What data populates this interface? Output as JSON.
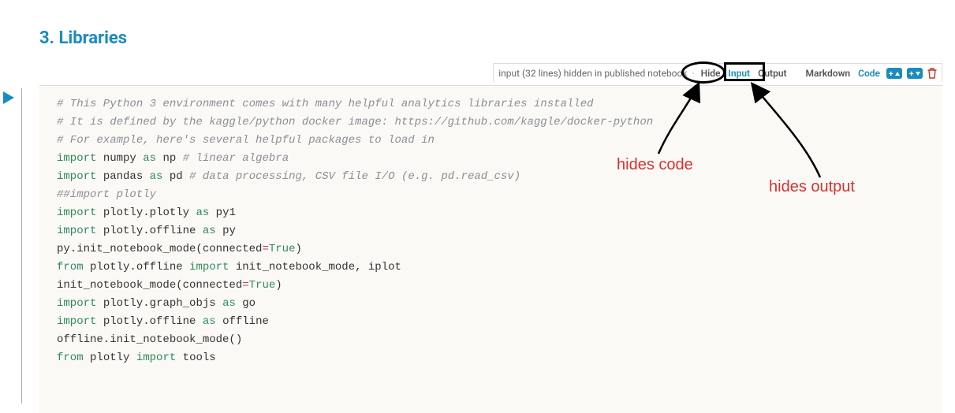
{
  "heading": "3. Libraries",
  "toolbar": {
    "hiddenMsg": "input (32 lines) hidden in published notebook",
    "separator": "·",
    "hide": "Hide",
    "input": "Input",
    "output": "Output",
    "markdown": "Markdown",
    "code": "Code"
  },
  "annotations": {
    "hidesCode": "hides code",
    "hidesOutput": "hides output"
  },
  "code": {
    "l1": "# This Python 3 environment comes with many helpful analytics libraries installed",
    "l2": "# It is defined by the kaggle/python docker image: https://github.com/kaggle/docker-python",
    "l3": "# For example, here's several helpful packages to load in",
    "blank1": " ",
    "imp": "import",
    "as": "as",
    "from": "from",
    "numpy": "numpy",
    "np": "np",
    "npComment": "# linear algebra",
    "pandas": "pandas",
    "pd": "pd",
    "pdComment": "# data processing, CSV file I/O (e.g. pd.read_csv)",
    "blank2": " ",
    "plotlyComment": "##import plotly",
    "plpl": "plotly.plotly",
    "py1": "py1",
    "ploff": "plotly.offline",
    "py": "py",
    "initcall": "py.init_notebook_mode(connected",
    "eq": "=",
    "true": "True",
    "closeParen": ")",
    "fromMods": "init_notebook_mode, iplot",
    "initcall2": "init_notebook_mode(connected",
    "graphobjs": "plotly.graph_objs",
    "go": "go",
    "offline": "offline",
    "offcall": "offline.init_notebook_mode()",
    "plotlyMod": "plotly",
    "tools": "tools"
  }
}
